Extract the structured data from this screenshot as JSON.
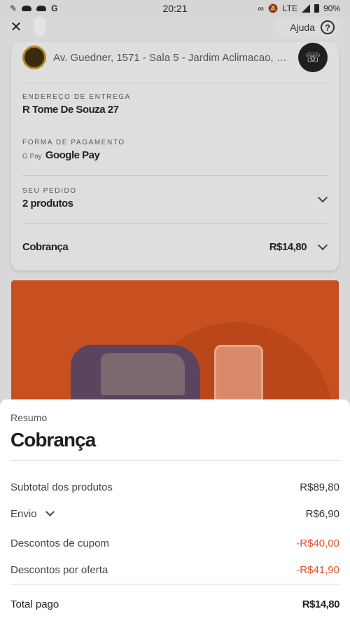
{
  "status_bar": {
    "time": "20:21",
    "network": "LTE",
    "battery": "90%"
  },
  "nav": {
    "close_glyph": "✕",
    "help_label": "Ajuda",
    "help_glyph": "?"
  },
  "store": {
    "address": "Av. Guedner, 1571 - Sala 5 - Jardim Aclimacao, Mari..."
  },
  "order_card": {
    "delivery_label": "ENDEREÇO DE ENTREGA",
    "delivery_value": "R Tome De Souza 27",
    "payment_label": "FORMA DE PAGAMENTO",
    "payment_mark": "G Pay",
    "payment_value": "Google Pay",
    "order_label": "SEU PEDIDO",
    "order_value": "2 produtos",
    "charge_label": "Cobrança",
    "charge_amount": "R$14,80"
  },
  "summary": {
    "kicker": "Resumo",
    "title": "Cobrança",
    "items": [
      {
        "label": "Subtotal dos produtos",
        "amount": "R$89,80"
      },
      {
        "label": "Envio",
        "amount": "R$6,90"
      },
      {
        "label": "Descontos de cupom",
        "amount": "-R$40,00"
      },
      {
        "label": "Descontos por oferta",
        "amount": "-R$41,90"
      }
    ],
    "total_label": "Total pago",
    "total_amount": "R$14,80"
  },
  "colors": {
    "discount": "#e0532a",
    "banner": "#c84f20"
  }
}
